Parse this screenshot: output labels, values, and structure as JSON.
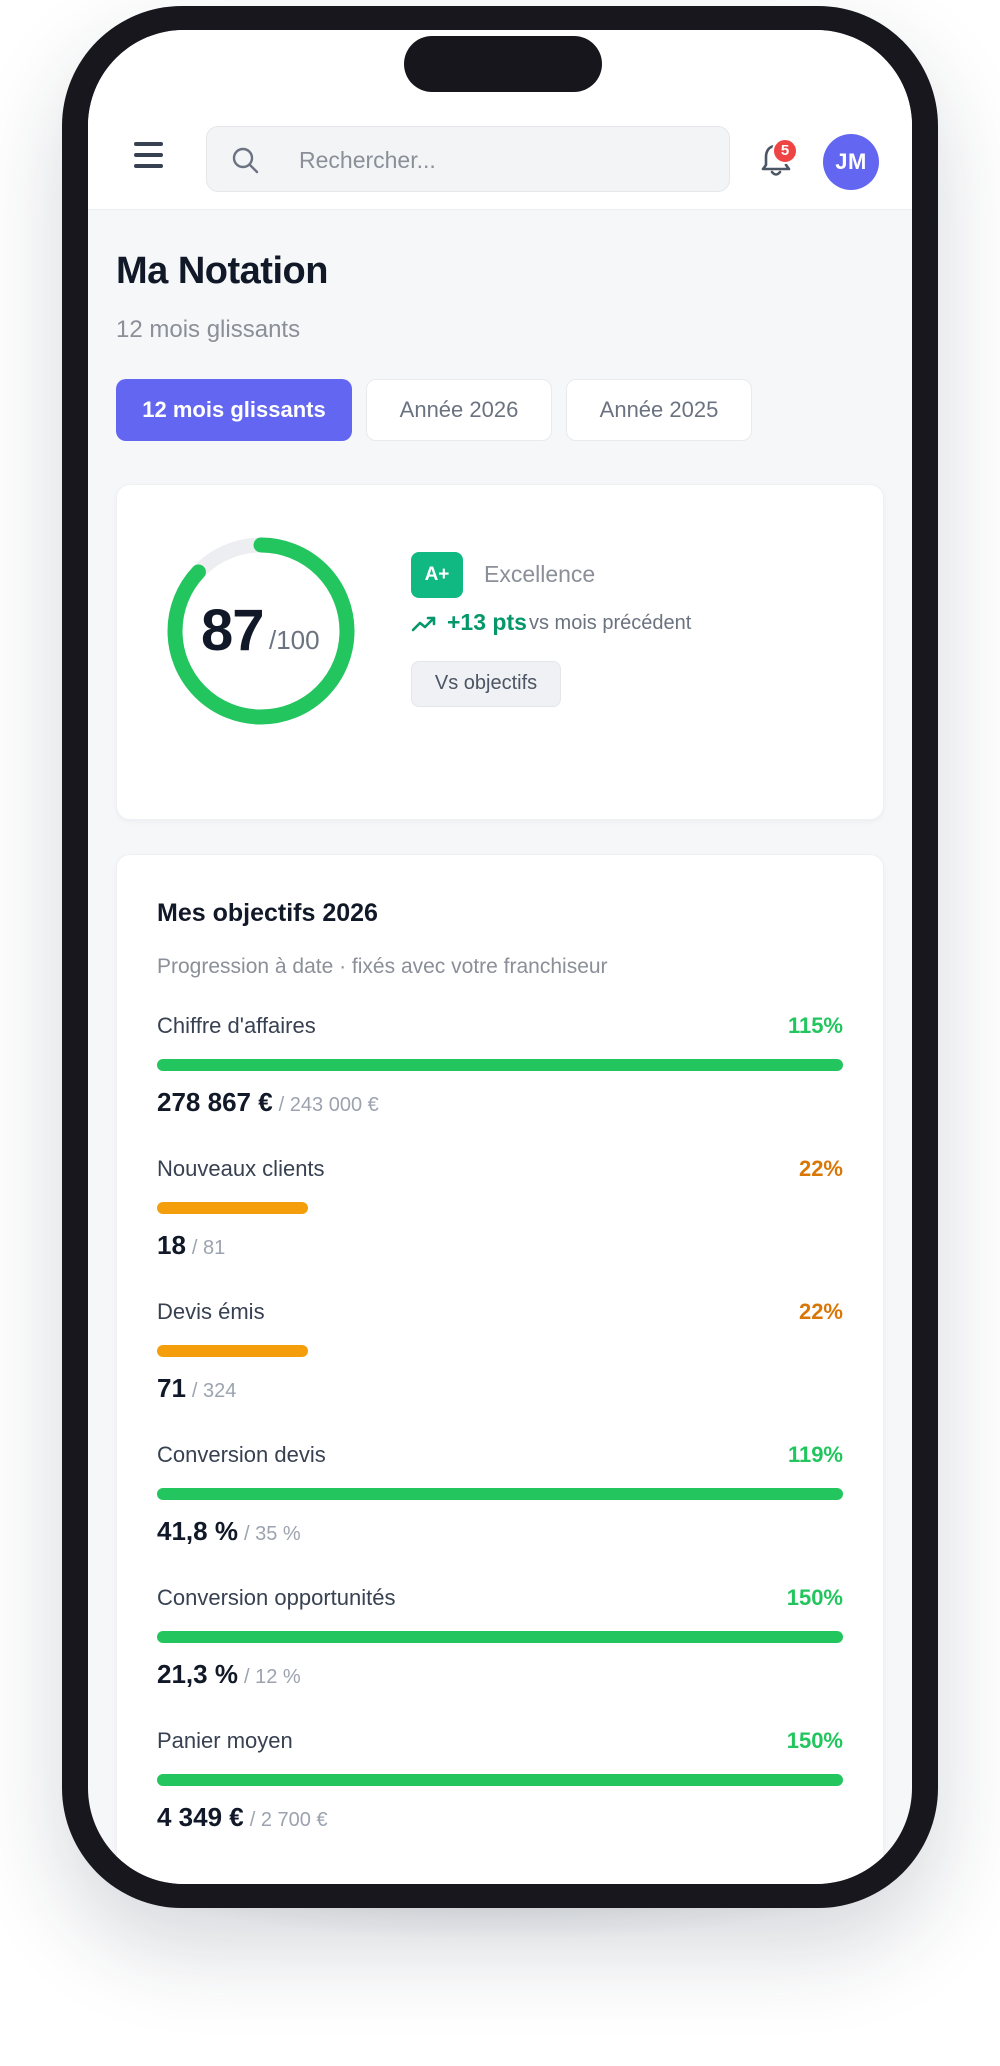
{
  "search": {
    "placeholder": "Rechercher..."
  },
  "notifications": {
    "count": "5"
  },
  "user": {
    "initials": "JM"
  },
  "page": {
    "title": "Ma Notation",
    "subtitle": "12 mois glissants"
  },
  "tabs": [
    {
      "label": "12 mois glissants",
      "active": true
    },
    {
      "label": "Année 2026",
      "active": false
    },
    {
      "label": "Année 2025",
      "active": false
    }
  ],
  "score": {
    "value": "87",
    "max": "/100",
    "fraction": 0.87,
    "grade": "A+",
    "grade_label": "Excellence",
    "trend_value": "+13 pts",
    "trend_text": "vs mois précédent",
    "compare_button": "Vs objectifs"
  },
  "goals": {
    "title": "Mes objectifs 2026",
    "subtitle": "Progression à date · fixés avec votre franchiseur",
    "items": [
      {
        "label": "Chiffre d'affaires",
        "pct": "115%",
        "progress": 1.15,
        "current": "278 867 €",
        "target": "/ 243 000 €"
      },
      {
        "label": "Nouveaux clients",
        "pct": "22%",
        "progress": 0.22,
        "current": "18",
        "target": "/ 81"
      },
      {
        "label": "Devis émis",
        "pct": "22%",
        "progress": 0.22,
        "current": "71",
        "target": "/ 324"
      },
      {
        "label": "Conversion devis",
        "pct": "119%",
        "progress": 1.19,
        "current": "41,8 %",
        "target": "/ 35 %"
      },
      {
        "label": "Conversion opportunités",
        "pct": "150%",
        "progress": 1.5,
        "current": "21,3 %",
        "target": "/ 12 %"
      },
      {
        "label": "Panier moyen",
        "pct": "150%",
        "progress": 1.5,
        "current": "4 349 €",
        "target": "/ 2 700 €"
      }
    ]
  },
  "colors": {
    "accent": "#6366f1",
    "success": "#22c55e",
    "warning": "#f59e0b",
    "grade_badge": "#10b981"
  }
}
